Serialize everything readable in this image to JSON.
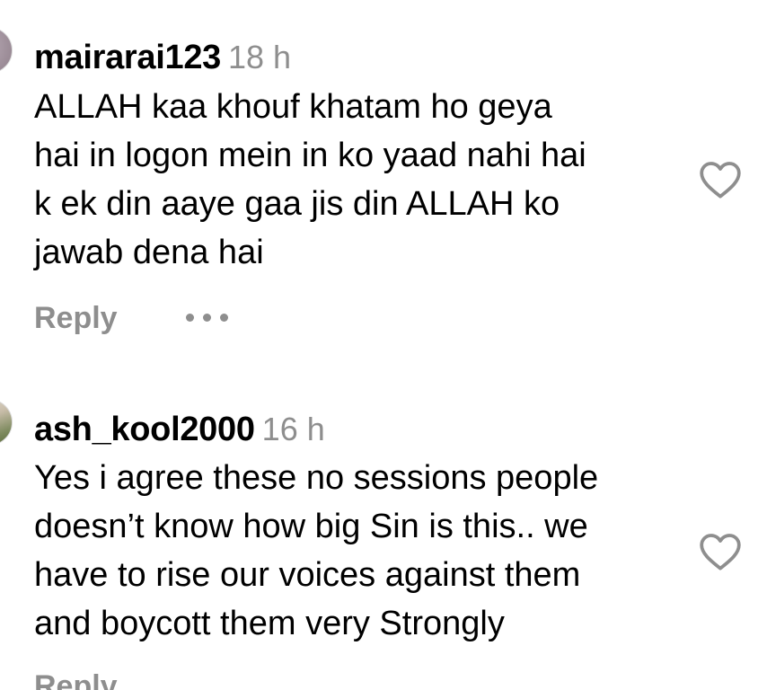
{
  "comments": [
    {
      "username": "mairarai123",
      "time": "18 h",
      "lines": [
        "ALLAH kaa khouf khatam ho geya",
        "hai in logon mein in ko yaad nahi hai",
        "k ek din aaye gaa jis din ALLAH ko",
        "jawab dena hai"
      ],
      "reply_label": "Reply",
      "more_icon": "more-horizontal-icon",
      "like_icon": "heart-outline-icon"
    },
    {
      "username": "ash_kool2000",
      "time": "16 h",
      "lines": [
        "Yes i agree these no sessions people",
        "doesn’t know how big Sin is this.. we",
        "have to rise our voices against them",
        "and boycott them very Strongly"
      ],
      "reply_label": "Reply",
      "like_icon": "heart-outline-icon"
    }
  ],
  "colors": {
    "text": "#000000",
    "secondary": "#8e8e8e",
    "background": "#ffffff"
  }
}
